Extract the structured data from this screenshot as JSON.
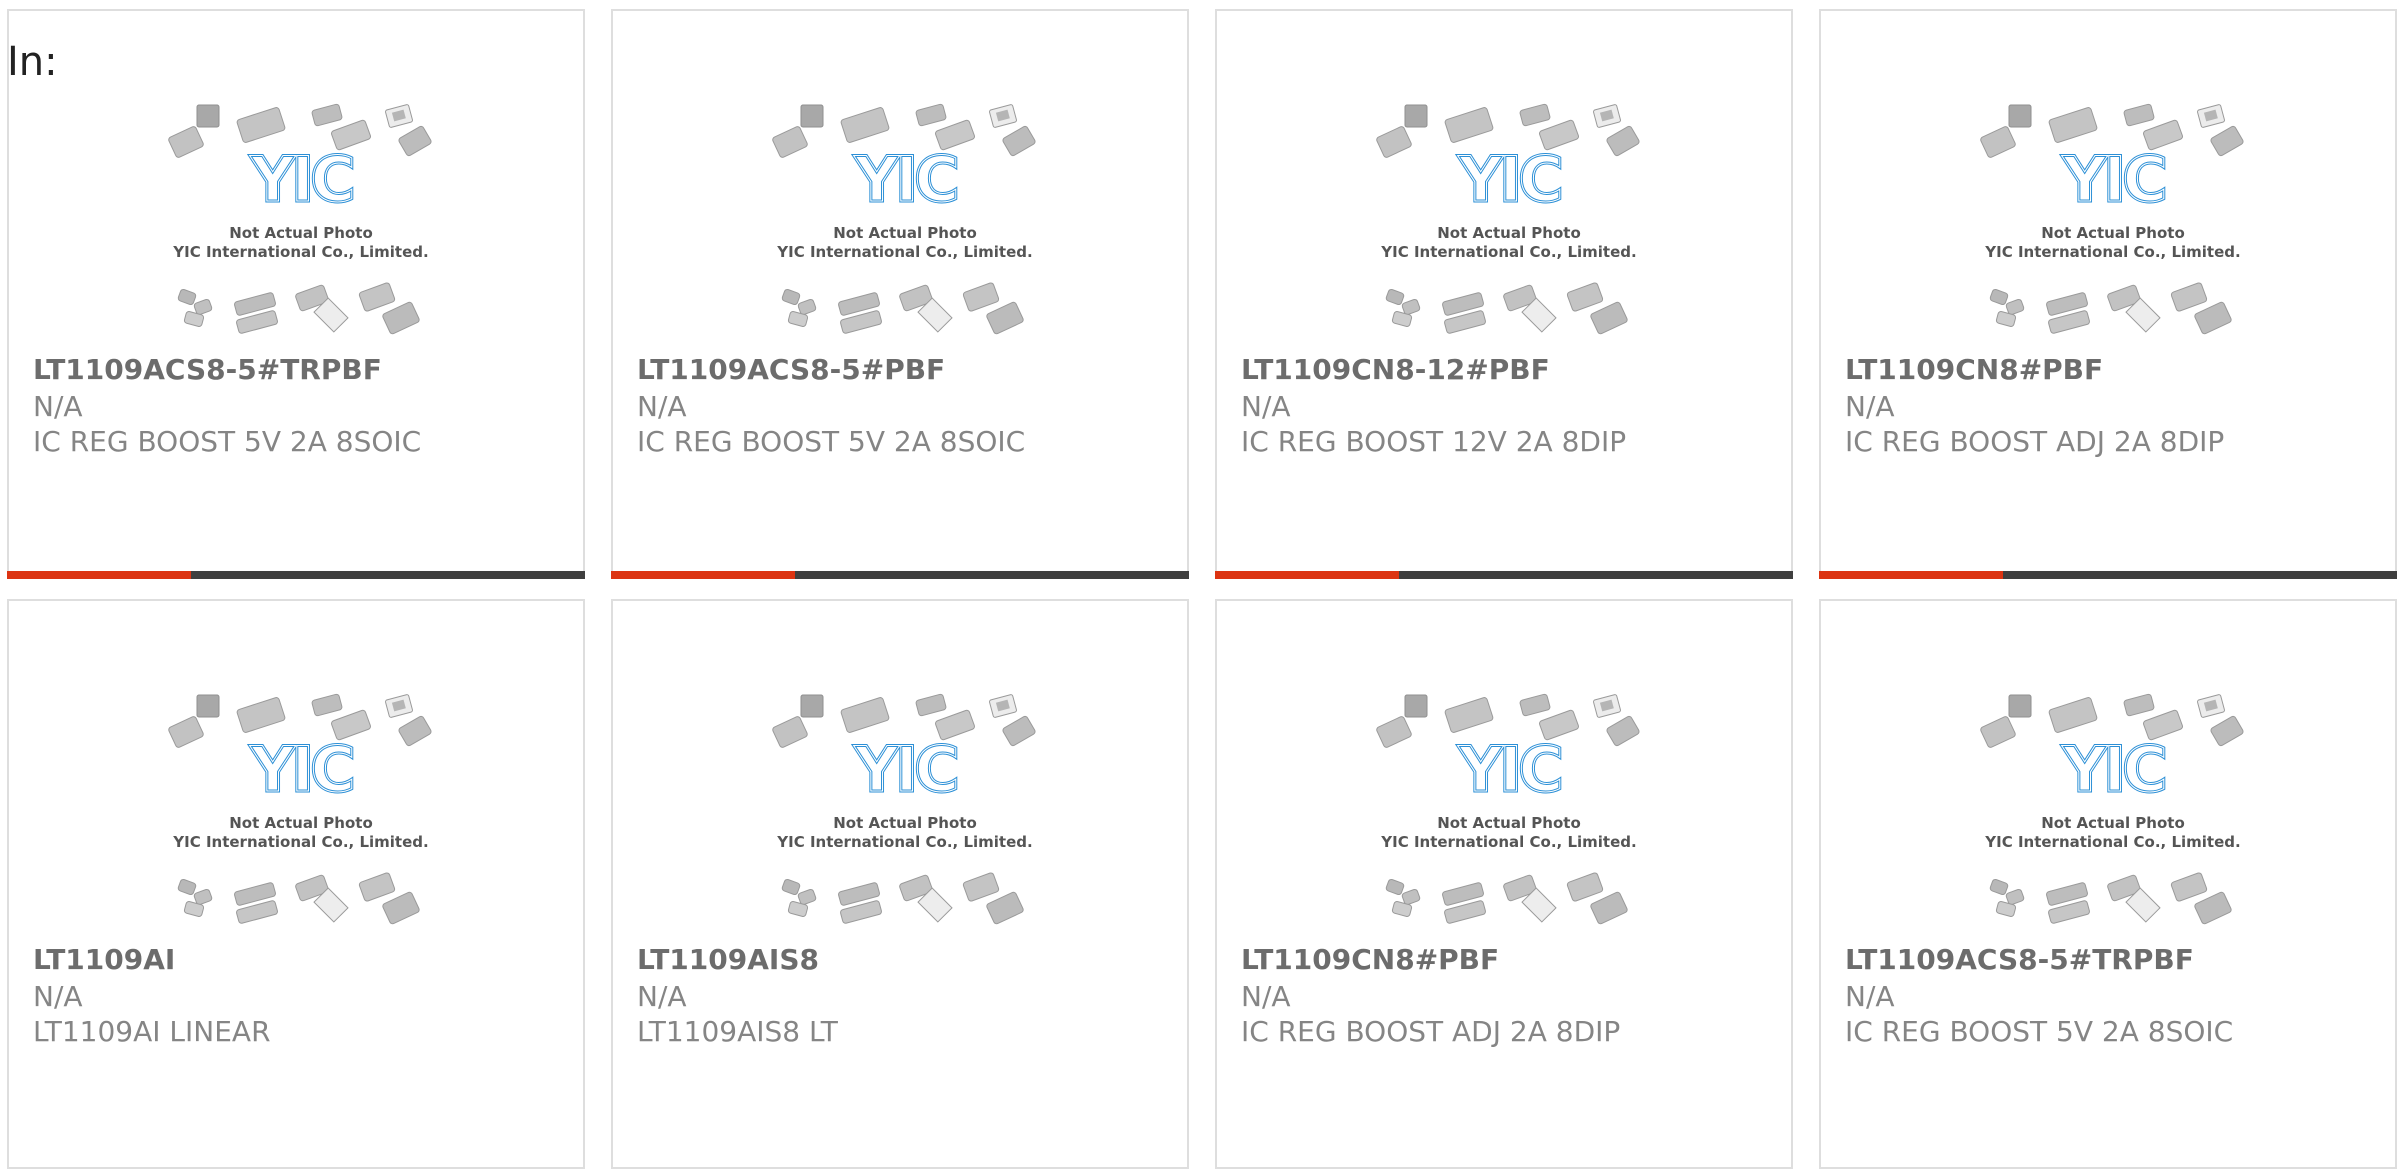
{
  "filter": {
    "label": "In:"
  },
  "theme": {
    "accent": "#dc3412",
    "bar": "#3f3f3f",
    "logo_blue": "#2b8fd6"
  },
  "photo": {
    "line1": "Not Actual Photo",
    "line2": "YIC International Co., Limited.",
    "logo_text": "YIC"
  },
  "products": [
    {
      "part_number": "LT1109ACS8-5#TRPBF",
      "manufacturer": "N/A",
      "description": "IC REG BOOST 5V 2A 8SOIC"
    },
    {
      "part_number": "LT1109ACS8-5#PBF",
      "manufacturer": "N/A",
      "description": "IC REG BOOST 5V 2A 8SOIC"
    },
    {
      "part_number": "LT1109CN8-12#PBF",
      "manufacturer": "N/A",
      "description": "IC REG BOOST 12V 2A 8DIP"
    },
    {
      "part_number": "LT1109CN8#PBF",
      "manufacturer": "N/A",
      "description": "IC REG BOOST ADJ 2A 8DIP"
    },
    {
      "part_number": "LT1109AI",
      "manufacturer": "N/A",
      "description": "LT1109AI LINEAR"
    },
    {
      "part_number": "LT1109AIS8",
      "manufacturer": "N/A",
      "description": "LT1109AIS8 LT"
    },
    {
      "part_number": "LT1109CN8#PBF",
      "manufacturer": "N/A",
      "description": "IC REG BOOST ADJ 2A 8DIP"
    },
    {
      "part_number": "LT1109ACS8-5#TRPBF",
      "manufacturer": "N/A",
      "description": "IC REG BOOST 5V 2A 8SOIC"
    }
  ]
}
